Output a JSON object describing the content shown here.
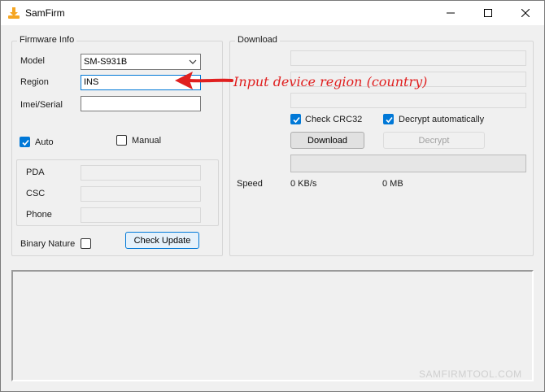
{
  "window": {
    "title": "SamFirm"
  },
  "firmware_info": {
    "legend": "Firmware Info",
    "model_label": "Model",
    "model_value": "SM-S931B",
    "region_label": "Region",
    "region_value": "INS",
    "imei_label": "Imei/Serial",
    "imei_value": "",
    "auto_label": "Auto",
    "auto_checked": true,
    "manual_label": "Manual",
    "manual_checked": false,
    "pda_label": "PDA",
    "csc_label": "CSC",
    "phone_label": "Phone",
    "binary_nature_label": "Binary Nature",
    "binary_nature_checked": false,
    "check_update_label": "Check Update"
  },
  "download": {
    "legend": "Download",
    "check_crc32_label": "Check CRC32",
    "check_crc32_checked": true,
    "decrypt_auto_label": "Decrypt automatically",
    "decrypt_auto_checked": true,
    "download_label": "Download",
    "decrypt_label": "Decrypt",
    "speed_label": "Speed",
    "speed_value": "0 KB/s",
    "size_value": "0 MB",
    "progress": 0
  },
  "annotation": {
    "text": "Input device region (country)",
    "color": "#e02020"
  },
  "watermark": "SAMFIRMTOOL.COM",
  "colors": {
    "accent": "#0078d7",
    "app_icon": "#f5a623"
  },
  "icons": {
    "app": "download-arrow-icon",
    "minimize": "minimize-icon",
    "maximize": "maximize-icon",
    "close": "close-icon",
    "dropdown": "chevron-down-icon",
    "check": "checkmark-icon",
    "arrow": "red-arrow-icon"
  }
}
